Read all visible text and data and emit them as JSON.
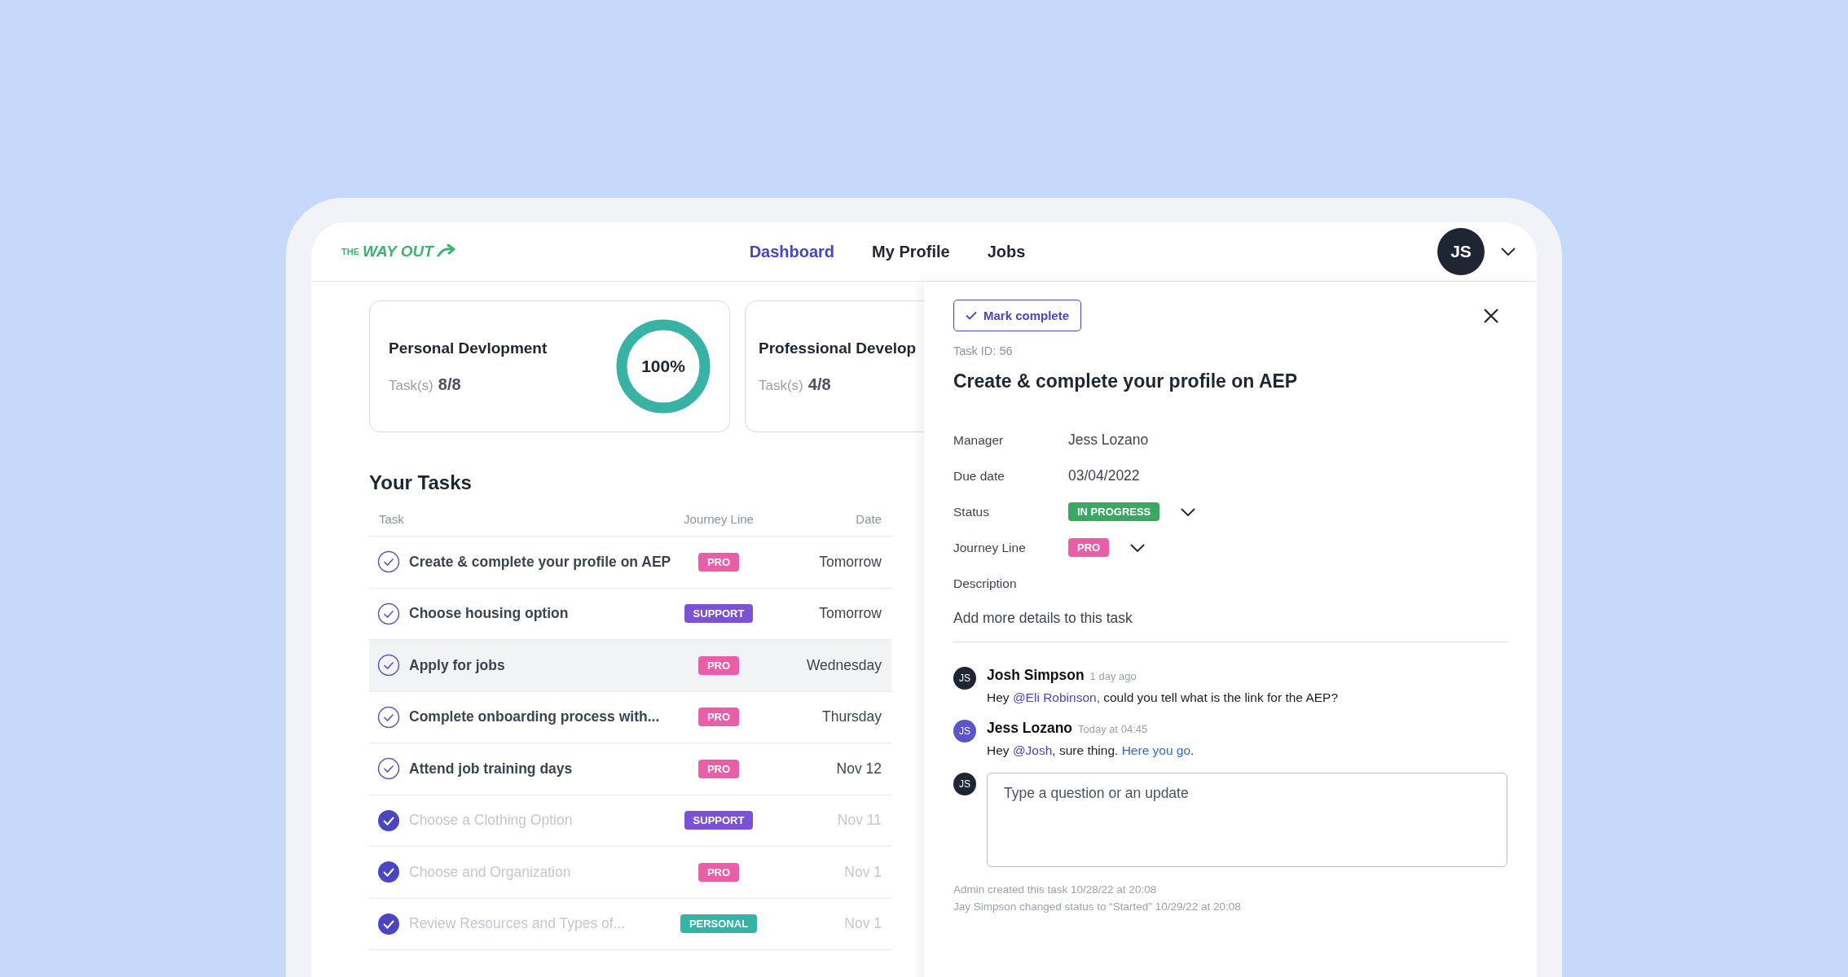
{
  "logo": {
    "small": "THE",
    "main": "WAY OUT"
  },
  "nav": [
    {
      "label": "Dashboard",
      "selected": true
    },
    {
      "label": "My Profile",
      "selected": false
    },
    {
      "label": "Jobs",
      "selected": false
    }
  ],
  "user": {
    "initials": "JS"
  },
  "cards": [
    {
      "title": "Personal Devlopment",
      "tasks_label": "Task(s)",
      "count": "8/8",
      "progress": {
        "level": 1,
        "label": "100%"
      }
    },
    {
      "title": "Professional Develop",
      "tasks_label": "Task(s)",
      "count": "4/8"
    }
  ],
  "tasks": {
    "title": "Your Tasks",
    "columns": [
      "Task",
      "Journey Line",
      "Date"
    ],
    "rows": [
      {
        "name": "Create & complete your profile on AEP",
        "tag": {
          "label": "PRO",
          "color": "#e95ea6"
        },
        "date": "Tomorrow",
        "completed": false,
        "selected": false
      },
      {
        "name": "Choose housing option",
        "tag": {
          "label": "SUPPORT",
          "color": "#7b52d6"
        },
        "date": "Tomorrow",
        "completed": false,
        "selected": false
      },
      {
        "name": "Apply for jobs",
        "tag": {
          "label": "PRO",
          "color": "#e95ea6"
        },
        "date": "Wednesday",
        "completed": false,
        "selected": true
      },
      {
        "name": "Complete onboarding process with...",
        "tag": {
          "label": "PRO",
          "color": "#e95ea6"
        },
        "date": "Thursday",
        "completed": false,
        "selected": false
      },
      {
        "name": "Attend job training days",
        "tag": {
          "label": "PRO",
          "color": "#e95ea6"
        },
        "date": "Nov 12",
        "completed": false,
        "selected": false
      },
      {
        "name": "Choose a Clothing Option",
        "tag": {
          "label": "SUPPORT",
          "color": "#7b52d6"
        },
        "date": "Nov 11",
        "completed": true,
        "selected": false
      },
      {
        "name": "Choose and Organization",
        "tag": {
          "label": "PRO",
          "color": "#e95ea6"
        },
        "date": "Nov 1",
        "completed": true,
        "selected": false
      },
      {
        "name": "Review Resources and Types of...",
        "tag": {
          "label": "PERSONAL",
          "color": "#35b3a4"
        },
        "date": "Nov 1",
        "completed": true,
        "selected": false
      }
    ]
  },
  "panel": {
    "mark_complete": "Mark complete",
    "task_id": "Task ID: 56",
    "title": "Create & complete your profile on AEP",
    "fields": [
      {
        "label": "Manager",
        "kind": "text",
        "value": "Jess Lozano"
      },
      {
        "label": "Due date",
        "kind": "text",
        "value": "03/04/2022"
      },
      {
        "label": "Status",
        "kind": "tag",
        "value": "IN PROGRESS",
        "color": "#3aa860"
      },
      {
        "label": "Journey Line",
        "kind": "tag",
        "value": "PRO",
        "color": "#e95ea6"
      },
      {
        "label": "Description",
        "kind": "heading"
      }
    ],
    "description": "Add more details to this task",
    "comments": [
      {
        "initials": "JS",
        "color": "#1f2633",
        "author": "Josh Simpson",
        "time": "1 day ago",
        "parts": [
          {
            "kind": "plain",
            "text": "Hey "
          },
          {
            "kind": "mention",
            "text": "@Eli Robinson,"
          },
          {
            "kind": "plain",
            "text": " could you tell what is the link for the AEP?"
          }
        ]
      },
      {
        "initials": "JS",
        "color": "#5b55c9",
        "author": "Jess Lozano",
        "time": "Today at 04:45",
        "parts": [
          {
            "kind": "plain",
            "text": "Hey "
          },
          {
            "kind": "mention",
            "text": "@Josh"
          },
          {
            "kind": "plain",
            "text": ", sure thing. "
          },
          {
            "kind": "link",
            "text": "Here you go"
          },
          {
            "kind": "plain",
            "text": "."
          }
        ]
      }
    ],
    "composer": {
      "initials": "JS",
      "placeholder": "Type a question or an update"
    },
    "history": [
      "Admin created this task 10/28/22 at 20:08",
      "Jay Simpson changed status to “Started” 10/29/22 at 20:08"
    ]
  }
}
